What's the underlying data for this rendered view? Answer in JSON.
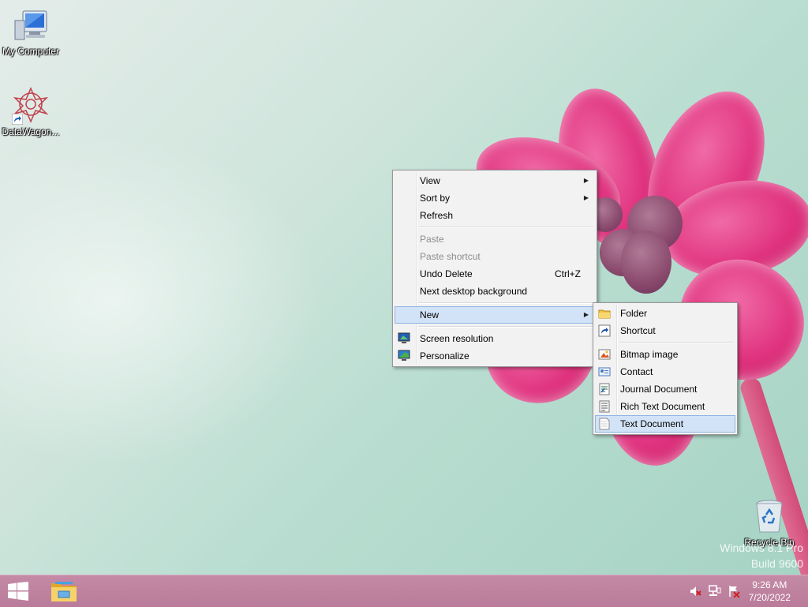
{
  "desktop": {
    "icons": [
      {
        "label": "My Computer",
        "icon": "computer-icon"
      },
      {
        "label": "DataWagon...",
        "icon": "datawagon-icon"
      },
      {
        "label": "Recycle Bin",
        "icon": "recycle-bin-icon"
      }
    ],
    "watermark": {
      "line1": "Windows 8.1 Pro",
      "line2": "Build 9600"
    }
  },
  "context_menu": {
    "items": [
      {
        "label": "View",
        "submenu": true
      },
      {
        "label": "Sort by",
        "submenu": true
      },
      {
        "label": "Refresh"
      },
      {
        "label": "Paste",
        "disabled": true
      },
      {
        "label": "Paste shortcut",
        "disabled": true
      },
      {
        "label": "Undo Delete",
        "shortcut": "Ctrl+Z"
      },
      {
        "label": "Next desktop background"
      },
      {
        "label": "New",
        "submenu": true,
        "highlighted": true
      },
      {
        "label": "Screen resolution",
        "icon": "screen-resolution-icon"
      },
      {
        "label": "Personalize",
        "icon": "personalize-icon"
      }
    ]
  },
  "new_submenu": {
    "items": [
      {
        "label": "Folder",
        "icon": "folder-icon"
      },
      {
        "label": "Shortcut",
        "icon": "shortcut-icon"
      },
      {
        "label": "Bitmap image",
        "icon": "bitmap-icon"
      },
      {
        "label": "Contact",
        "icon": "contact-icon"
      },
      {
        "label": "Journal Document",
        "icon": "journal-icon"
      },
      {
        "label": "Rich Text Document",
        "icon": "rich-text-icon"
      },
      {
        "label": "Text Document",
        "icon": "text-document-icon",
        "highlighted": true
      }
    ]
  },
  "taskbar": {
    "start_icon": "windows-logo-icon",
    "pinned": [
      {
        "icon": "file-explorer-icon"
      }
    ],
    "tray": [
      {
        "icon": "volume-muted-icon"
      },
      {
        "icon": "network-icon"
      },
      {
        "icon": "action-center-icon"
      }
    ],
    "clock": {
      "time": "9:26 AM",
      "date": "7/20/2022"
    }
  },
  "colors": {
    "menu_highlight": "#d2e3f7",
    "taskbar": "#c48aa6"
  }
}
